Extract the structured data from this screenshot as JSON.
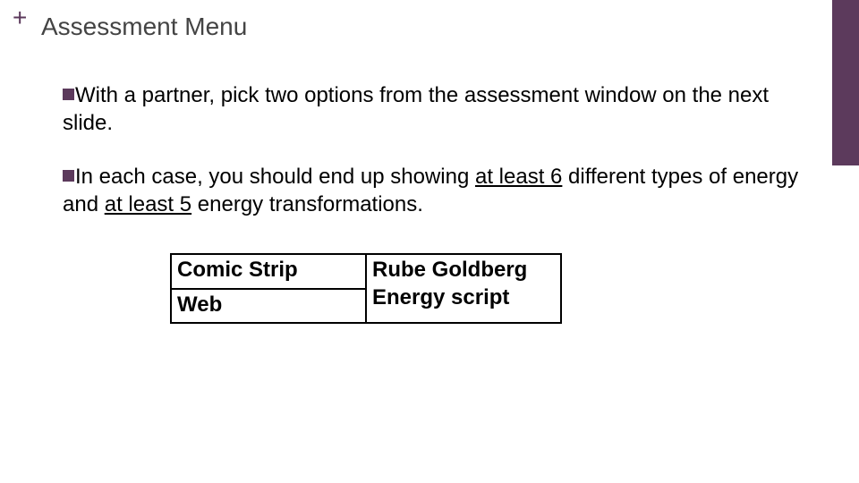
{
  "header": {
    "plus": "+",
    "title": "Assessment Menu"
  },
  "bullets": {
    "b1_lead": "With",
    "b1_rest": " a partner, pick two options from the assessment window on the next slide.",
    "b2_lead": "In",
    "b2_a": " each case, you should end up showing ",
    "b2_u1": "at least 6",
    "b2_b": " different types of energy and ",
    "b2_u2": "at least 5",
    "b2_c": " energy transformations."
  },
  "options": {
    "r0c0": "Comic Strip",
    "r0c1": "Rube Goldberg",
    "r1c0": "Web",
    "r1c1": "Energy script"
  }
}
